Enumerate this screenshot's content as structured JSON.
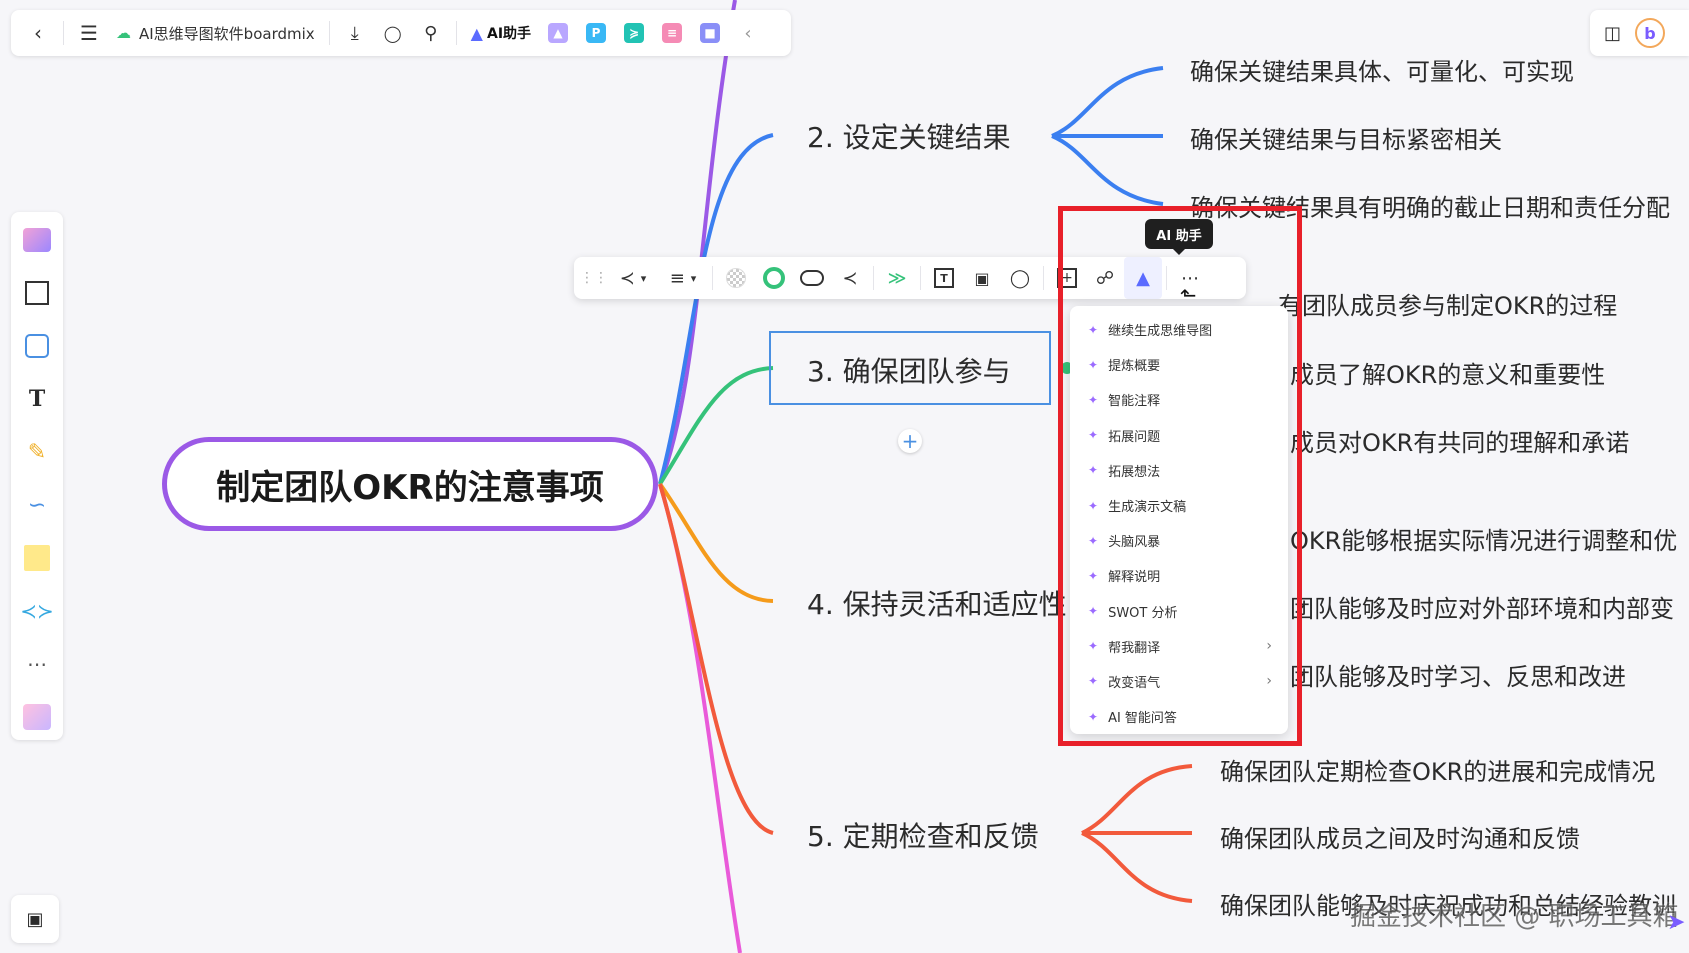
{
  "topbar": {
    "title": "AI思维导图软件boardmix",
    "ai_label": "AI助手",
    "icons": [
      "back-icon",
      "menu-icon",
      "cloud-icon",
      "download-icon",
      "tag-icon",
      "search-icon",
      "ai-logo-icon",
      "image-app-icon",
      "p-app-icon",
      "flow-app-icon",
      "mindmap-app-icon",
      "chat-app-icon",
      "collapse-icon"
    ]
  },
  "topright": {
    "icons": [
      "gift-box-icon",
      "boardmix-logo-icon"
    ]
  },
  "left_toolbar": {
    "icons": [
      "template-icon",
      "frame-icon",
      "shape-icon",
      "text-icon",
      "pen-icon",
      "connector-icon",
      "sticky-note-icon",
      "mindmap-icon",
      "more-icon",
      "plugin-icon"
    ]
  },
  "mindmap": {
    "root": "制定团队OKR的注意事项",
    "branches": [
      {
        "label": "2. 设定关键结果",
        "color": "#3b7ff0",
        "leaves": [
          "确保关键结果具体、可量化、可实现",
          "确保关键结果与目标紧密相关",
          "确保关键结果具有明确的截止日期和责任分配"
        ]
      },
      {
        "label": "3. 确保团队参与",
        "color": "#35c27a",
        "leaves": [
          "确保所有团队成员参与制定OKR的过程",
          "确保团队成员了解OKR的意义和重要性",
          "确保团队成员对OKR有共同的理解和承诺"
        ]
      },
      {
        "label": "4. 保持灵活和适应性",
        "color": "#f59b1b",
        "leaves": [
          "确保OKR能够根据实际情况进行调整和优化",
          "确保团队能够及时应对外部环境和内部变化",
          "确保团队能够及时学习、反思和改进"
        ]
      },
      {
        "label": "5. 定期检查和反馈",
        "color": "#f25a3c",
        "leaves": [
          "确保团队定期检查OKR的进展和完成情况",
          "确保团队成员之间及时沟通和反馈",
          "确保团队能够及时庆祝成功和总结经验教训"
        ]
      }
    ]
  },
  "visible_leaf_text": {
    "b2": [
      "确保关键结果具体、可量化、可实现",
      "确保关键结果与目标紧密相关",
      "确保关键结果具有明确的截止日期和责任分配"
    ],
    "b3": [
      "有团队成员参与制定OKR的过程",
      "成员了解OKR的意义和重要性",
      "成员对OKR有共同的理解和承诺"
    ],
    "b4": [
      "OKR能够根据实际情况进行调整和优",
      "团队能够及时应对外部环境和内部变",
      "团队能够及时学习、反思和改进"
    ],
    "b5": [
      "确保团队定期检查OKR的进展和完成情况",
      "确保团队成员之间及时沟通和反馈",
      "确保团队能够及时庆祝成功和总结经验教训"
    ]
  },
  "floating_toolbar": {
    "icons": [
      "layout-icon",
      "align-icon",
      "fill-icon",
      "border-color-icon",
      "shape-oval-icon",
      "branch-style-icon",
      "branch-color-icon",
      "text-box-icon",
      "format-painter-icon",
      "comment-icon",
      "add-node-icon",
      "link-icon",
      "ai-assistant-icon",
      "more-icon"
    ]
  },
  "tooltip": "AI 助手",
  "ai_menu": {
    "items": [
      {
        "label": "继续生成思维导图",
        "submenu": false
      },
      {
        "label": "提炼概要",
        "submenu": false
      },
      {
        "label": "智能注释",
        "submenu": false
      },
      {
        "label": "拓展问题",
        "submenu": false
      },
      {
        "label": "拓展想法",
        "submenu": false
      },
      {
        "label": "生成演示文稿",
        "submenu": false
      },
      {
        "label": "头脑风暴",
        "submenu": false
      },
      {
        "label": "解释说明",
        "submenu": false
      },
      {
        "label": "SWOT 分析",
        "submenu": false
      },
      {
        "label": "帮我翻译",
        "submenu": true
      },
      {
        "label": "改变语气",
        "submenu": true
      },
      {
        "label": "AI 智能问答",
        "submenu": false
      }
    ]
  },
  "watermark": "掘金技术社区 @ 职场工具箱",
  "colors": {
    "root_border": "#9b59e6",
    "selection": "#4a90e2",
    "highlight": "#e8202a"
  }
}
